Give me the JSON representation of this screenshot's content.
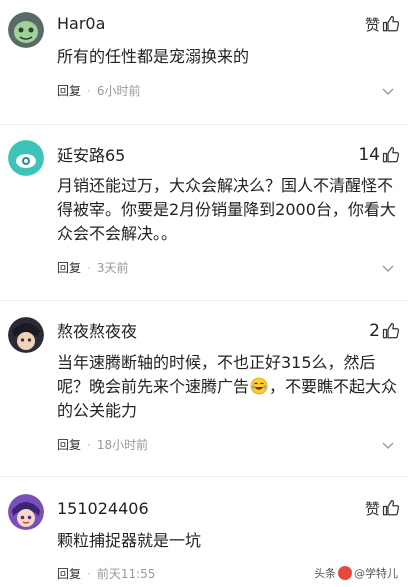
{
  "comments": [
    {
      "username": "Har0a",
      "like_label": "赞",
      "like_count": "",
      "text": "所有的任性都是宠溺换来的",
      "reply_label": "回复",
      "time": "6小时前"
    },
    {
      "username": "延安路65",
      "like_label": "",
      "like_count": "14",
      "text": "月销还能过万，大众会解决么？国人不清醒怪不得被宰。你要是2月份销量降到2000台，你看大众会不会解决。。",
      "reply_label": "回复",
      "time": "3天前"
    },
    {
      "username": "熬夜熬夜夜",
      "like_label": "",
      "like_count": "2",
      "text_before_emoji": "当年速腾断轴的时候，不也正好315么，然后呢？晚会前先来个速腾广告",
      "text_after_emoji": "，不要瞧不起大众的公关能力",
      "reply_label": "回复",
      "time": "18小时前"
    },
    {
      "username": "151024406",
      "like_label": "赞",
      "like_count": "",
      "text": "颗粒捕捉器就是一坑",
      "reply_label": "回复",
      "time": "前天11:55"
    }
  ],
  "watermark": {
    "prefix": "头条",
    "author": "@学特儿"
  },
  "colors": {
    "text": "#222222",
    "meta": "#999999",
    "divider": "#f0f0f0"
  }
}
